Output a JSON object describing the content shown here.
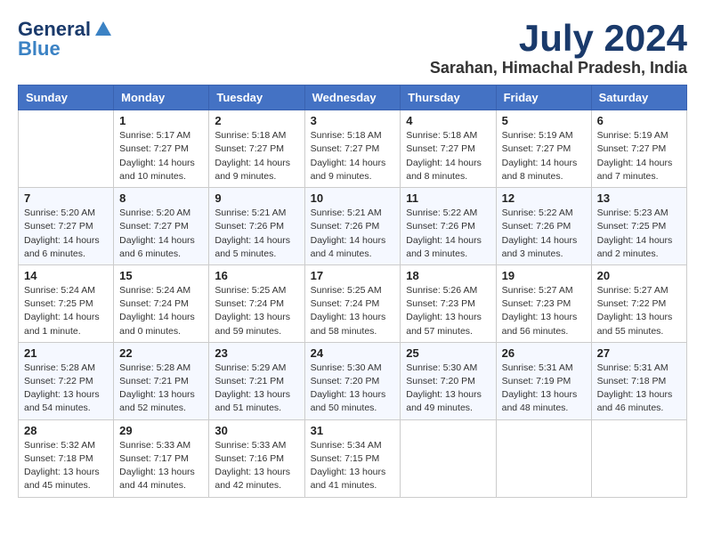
{
  "logo": {
    "general": "General",
    "blue": "Blue"
  },
  "title": {
    "month": "July 2024",
    "location": "Sarahan, Himachal Pradesh, India"
  },
  "days_of_week": [
    "Sunday",
    "Monday",
    "Tuesday",
    "Wednesday",
    "Thursday",
    "Friday",
    "Saturday"
  ],
  "weeks": [
    [
      {
        "day": "",
        "sunrise": "",
        "sunset": "",
        "daylight": ""
      },
      {
        "day": "1",
        "sunrise": "Sunrise: 5:17 AM",
        "sunset": "Sunset: 7:27 PM",
        "daylight": "Daylight: 14 hours and 10 minutes."
      },
      {
        "day": "2",
        "sunrise": "Sunrise: 5:18 AM",
        "sunset": "Sunset: 7:27 PM",
        "daylight": "Daylight: 14 hours and 9 minutes."
      },
      {
        "day": "3",
        "sunrise": "Sunrise: 5:18 AM",
        "sunset": "Sunset: 7:27 PM",
        "daylight": "Daylight: 14 hours and 9 minutes."
      },
      {
        "day": "4",
        "sunrise": "Sunrise: 5:18 AM",
        "sunset": "Sunset: 7:27 PM",
        "daylight": "Daylight: 14 hours and 8 minutes."
      },
      {
        "day": "5",
        "sunrise": "Sunrise: 5:19 AM",
        "sunset": "Sunset: 7:27 PM",
        "daylight": "Daylight: 14 hours and 8 minutes."
      },
      {
        "day": "6",
        "sunrise": "Sunrise: 5:19 AM",
        "sunset": "Sunset: 7:27 PM",
        "daylight": "Daylight: 14 hours and 7 minutes."
      }
    ],
    [
      {
        "day": "7",
        "sunrise": "Sunrise: 5:20 AM",
        "sunset": "Sunset: 7:27 PM",
        "daylight": "Daylight: 14 hours and 6 minutes."
      },
      {
        "day": "8",
        "sunrise": "Sunrise: 5:20 AM",
        "sunset": "Sunset: 7:27 PM",
        "daylight": "Daylight: 14 hours and 6 minutes."
      },
      {
        "day": "9",
        "sunrise": "Sunrise: 5:21 AM",
        "sunset": "Sunset: 7:26 PM",
        "daylight": "Daylight: 14 hours and 5 minutes."
      },
      {
        "day": "10",
        "sunrise": "Sunrise: 5:21 AM",
        "sunset": "Sunset: 7:26 PM",
        "daylight": "Daylight: 14 hours and 4 minutes."
      },
      {
        "day": "11",
        "sunrise": "Sunrise: 5:22 AM",
        "sunset": "Sunset: 7:26 PM",
        "daylight": "Daylight: 14 hours and 3 minutes."
      },
      {
        "day": "12",
        "sunrise": "Sunrise: 5:22 AM",
        "sunset": "Sunset: 7:26 PM",
        "daylight": "Daylight: 14 hours and 3 minutes."
      },
      {
        "day": "13",
        "sunrise": "Sunrise: 5:23 AM",
        "sunset": "Sunset: 7:25 PM",
        "daylight": "Daylight: 14 hours and 2 minutes."
      }
    ],
    [
      {
        "day": "14",
        "sunrise": "Sunrise: 5:24 AM",
        "sunset": "Sunset: 7:25 PM",
        "daylight": "Daylight: 14 hours and 1 minute."
      },
      {
        "day": "15",
        "sunrise": "Sunrise: 5:24 AM",
        "sunset": "Sunset: 7:24 PM",
        "daylight": "Daylight: 14 hours and 0 minutes."
      },
      {
        "day": "16",
        "sunrise": "Sunrise: 5:25 AM",
        "sunset": "Sunset: 7:24 PM",
        "daylight": "Daylight: 13 hours and 59 minutes."
      },
      {
        "day": "17",
        "sunrise": "Sunrise: 5:25 AM",
        "sunset": "Sunset: 7:24 PM",
        "daylight": "Daylight: 13 hours and 58 minutes."
      },
      {
        "day": "18",
        "sunrise": "Sunrise: 5:26 AM",
        "sunset": "Sunset: 7:23 PM",
        "daylight": "Daylight: 13 hours and 57 minutes."
      },
      {
        "day": "19",
        "sunrise": "Sunrise: 5:27 AM",
        "sunset": "Sunset: 7:23 PM",
        "daylight": "Daylight: 13 hours and 56 minutes."
      },
      {
        "day": "20",
        "sunrise": "Sunrise: 5:27 AM",
        "sunset": "Sunset: 7:22 PM",
        "daylight": "Daylight: 13 hours and 55 minutes."
      }
    ],
    [
      {
        "day": "21",
        "sunrise": "Sunrise: 5:28 AM",
        "sunset": "Sunset: 7:22 PM",
        "daylight": "Daylight: 13 hours and 54 minutes."
      },
      {
        "day": "22",
        "sunrise": "Sunrise: 5:28 AM",
        "sunset": "Sunset: 7:21 PM",
        "daylight": "Daylight: 13 hours and 52 minutes."
      },
      {
        "day": "23",
        "sunrise": "Sunrise: 5:29 AM",
        "sunset": "Sunset: 7:21 PM",
        "daylight": "Daylight: 13 hours and 51 minutes."
      },
      {
        "day": "24",
        "sunrise": "Sunrise: 5:30 AM",
        "sunset": "Sunset: 7:20 PM",
        "daylight": "Daylight: 13 hours and 50 minutes."
      },
      {
        "day": "25",
        "sunrise": "Sunrise: 5:30 AM",
        "sunset": "Sunset: 7:20 PM",
        "daylight": "Daylight: 13 hours and 49 minutes."
      },
      {
        "day": "26",
        "sunrise": "Sunrise: 5:31 AM",
        "sunset": "Sunset: 7:19 PM",
        "daylight": "Daylight: 13 hours and 48 minutes."
      },
      {
        "day": "27",
        "sunrise": "Sunrise: 5:31 AM",
        "sunset": "Sunset: 7:18 PM",
        "daylight": "Daylight: 13 hours and 46 minutes."
      }
    ],
    [
      {
        "day": "28",
        "sunrise": "Sunrise: 5:32 AM",
        "sunset": "Sunset: 7:18 PM",
        "daylight": "Daylight: 13 hours and 45 minutes."
      },
      {
        "day": "29",
        "sunrise": "Sunrise: 5:33 AM",
        "sunset": "Sunset: 7:17 PM",
        "daylight": "Daylight: 13 hours and 44 minutes."
      },
      {
        "day": "30",
        "sunrise": "Sunrise: 5:33 AM",
        "sunset": "Sunset: 7:16 PM",
        "daylight": "Daylight: 13 hours and 42 minutes."
      },
      {
        "day": "31",
        "sunrise": "Sunrise: 5:34 AM",
        "sunset": "Sunset: 7:15 PM",
        "daylight": "Daylight: 13 hours and 41 minutes."
      },
      {
        "day": "",
        "sunrise": "",
        "sunset": "",
        "daylight": ""
      },
      {
        "day": "",
        "sunrise": "",
        "sunset": "",
        "daylight": ""
      },
      {
        "day": "",
        "sunrise": "",
        "sunset": "",
        "daylight": ""
      }
    ]
  ]
}
